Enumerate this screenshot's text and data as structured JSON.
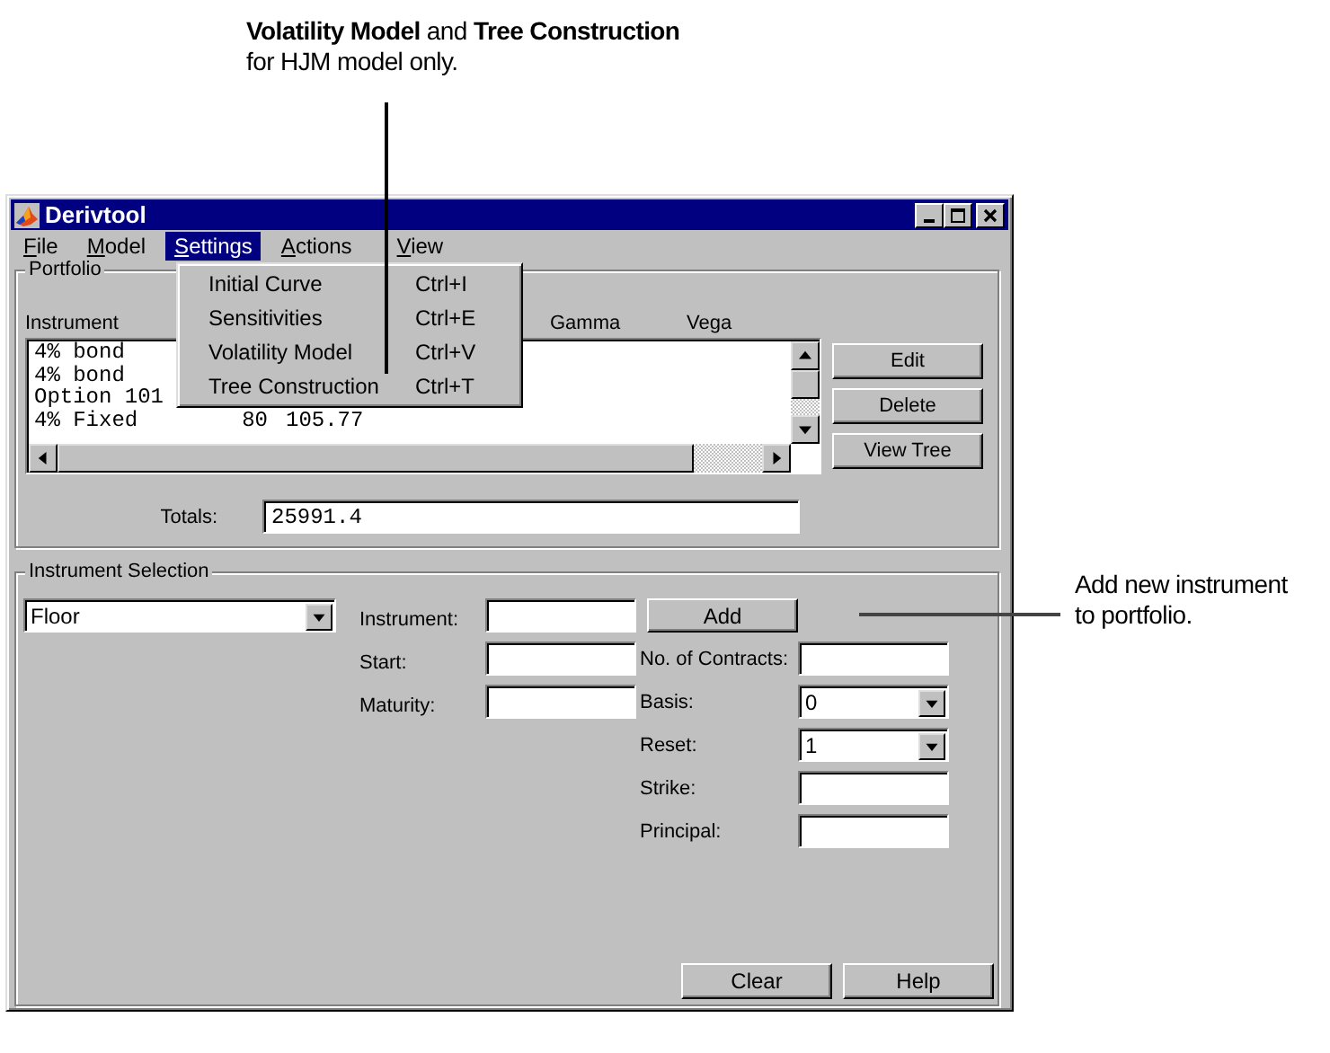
{
  "annotations": [
    {
      "lines": [
        "**Volatility Model** and **Tree Construction**",
        "for HJM model only."
      ]
    },
    {
      "lines": [
        "Add new instrument",
        "to portfolio."
      ]
    }
  ],
  "window": {
    "title": "Derivtool"
  },
  "menubar": [
    {
      "label": "File",
      "selected": false
    },
    {
      "label": "Model",
      "selected": false
    },
    {
      "label": "Settings",
      "selected": true
    },
    {
      "label": "Actions",
      "selected": false
    },
    {
      "label": "View",
      "selected": false
    }
  ],
  "settings_menu": [
    {
      "label": "Initial Curve",
      "shortcut": "Ctrl+I"
    },
    {
      "label": "Sensitivities",
      "shortcut": "Ctrl+E"
    },
    {
      "label": "Volatility Model",
      "shortcut": "Ctrl+V"
    },
    {
      "label": "Tree Construction",
      "shortcut": "Ctrl+T"
    }
  ],
  "portfolio": {
    "title": "Portfolio",
    "columns": [
      "Instrument",
      "Gamma",
      "Vega"
    ],
    "rows": [
      {
        "cells": [
          "4% bond"
        ]
      },
      {
        "cells": [
          "4% bond"
        ]
      },
      {
        "cells": [
          "Option 101"
        ]
      },
      {
        "cells": [
          "4% Fixed",
          "80",
          "105.77"
        ]
      }
    ],
    "buttons": [
      "Edit",
      "Delete",
      "View Tree"
    ],
    "totals_label": "Totals:",
    "totals_value": "25991.4"
  },
  "instrument_selection": {
    "title": "Instrument Selection",
    "type_value": "Floor",
    "left_fields": [
      {
        "label": "Instrument:",
        "kind": "text"
      },
      {
        "label": "Start:",
        "kind": "text"
      },
      {
        "label": "Maturity:",
        "kind": "text"
      }
    ],
    "add_button": "Add",
    "right_fields": [
      {
        "label": "No. of Contracts:",
        "kind": "text"
      },
      {
        "label": "Basis:",
        "kind": "dropdown",
        "value": "0"
      },
      {
        "label": "Reset:",
        "kind": "dropdown",
        "value": "1"
      },
      {
        "label": "Strike:",
        "kind": "text"
      },
      {
        "label": "Principal:",
        "kind": "text"
      }
    ],
    "buttons": [
      "Clear",
      "Help"
    ]
  }
}
